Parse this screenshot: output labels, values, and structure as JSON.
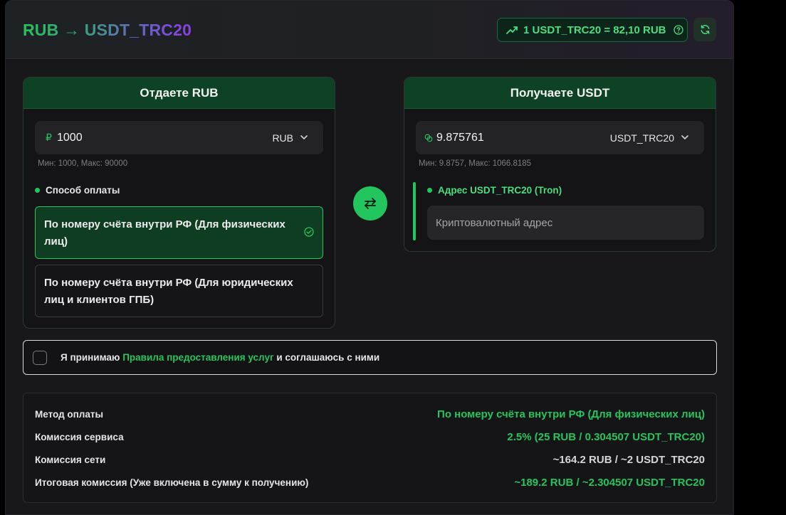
{
  "header": {
    "title": "RUB → USDT_TRC20",
    "rate": "1 USDT_TRC20 = 82,10 RUB",
    "icons": {
      "trend": "trending-up-icon",
      "help": "help-circle-icon",
      "refresh": "refresh-icon"
    }
  },
  "give": {
    "heading": "Отдаете RUB",
    "currency_symbol": "₽",
    "amount": "1000",
    "currency": "RUB",
    "limits": "Мин: 1000, Макс: 90000",
    "payment_label": "Способ оплаты",
    "payment_options": [
      {
        "label": "По номеру счёта внутри РФ (Для физических лиц)",
        "selected": true
      },
      {
        "label": "По номеру счёта внутри РФ (Для юридических лиц и клиентов ГПБ)",
        "selected": false
      }
    ]
  },
  "receive": {
    "heading": "Получаете USDT",
    "amount": "9.875761",
    "currency": "USDT_TRC20",
    "limits": "Мин: 9.8757, Макс: 1066.8185",
    "address_label": "Адрес USDT_TRC20 (Tron)",
    "address_placeholder": "Криптовалютный адрес"
  },
  "agreement": {
    "prefix": "Я принимаю ",
    "link": "Правила предоставления услуг",
    "suffix": " и соглашаюсь с ними",
    "checked": false
  },
  "summary": [
    {
      "label": "Метод оплаты",
      "value": "По номеру счёта внутри РФ (Для физических лиц)"
    },
    {
      "label": "Комиссия сервиса",
      "value": "2.5% (25 RUB / 0.304507 USDT_TRC20)"
    },
    {
      "label": "Комиссия сети",
      "value": "~164.2 RUB / ~2 USDT_TRC20"
    },
    {
      "label": "Итоговая комиссия (Уже включена в сумму к получению)",
      "value": "~189.2 RUB / ~2.304507 USDT_TRC20"
    }
  ],
  "colors": {
    "accent": "#22c55e",
    "card_header": "#0e4224",
    "background": "#18181b"
  }
}
